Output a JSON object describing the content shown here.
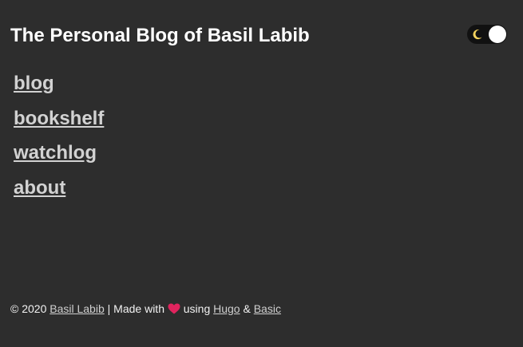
{
  "header": {
    "title": "The Personal Blog of Basil Labib",
    "theme_toggle": {
      "moon_icon": "crescent-moon-icon",
      "state": "dark",
      "track_color": "#111111",
      "moon_color": "#f4d35e",
      "knob_color": "#ffffff"
    }
  },
  "nav": {
    "items": [
      {
        "label": "blog"
      },
      {
        "label": "bookshelf"
      },
      {
        "label": "watchlog"
      },
      {
        "label": "about"
      }
    ]
  },
  "footer": {
    "copyright": "© 2020",
    "author": "Basil Labib",
    "made_with": "| Made with",
    "heart_icon": "red-heart-icon",
    "heart_color": "#e0245e",
    "using": "using",
    "hugo": "Hugo",
    "ampersand": "&",
    "basic": "Basic"
  },
  "colors": {
    "background": "#2d2d2d",
    "text": "#f2f2f2",
    "link": "#d2d2d2"
  }
}
